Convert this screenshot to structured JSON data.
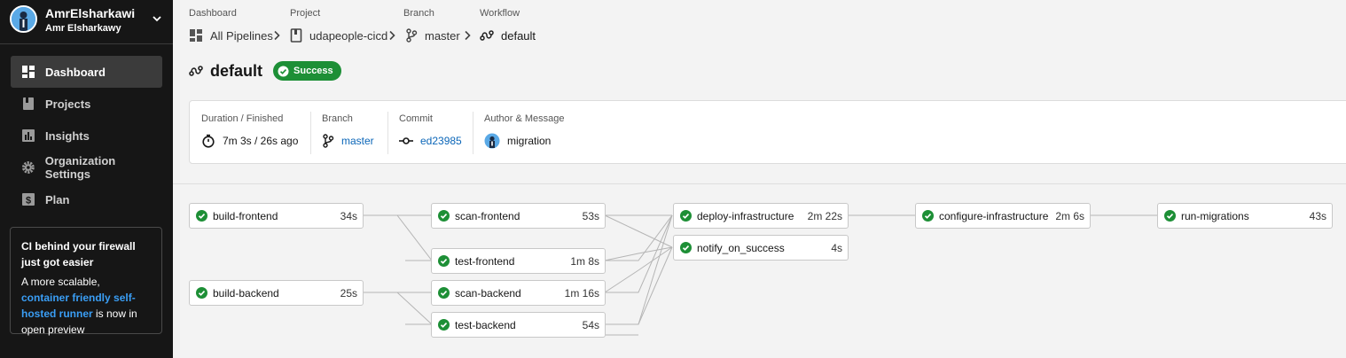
{
  "user": {
    "name": "AmrElsharkawi",
    "subname": "Amr Elsharkawy"
  },
  "nav": [
    {
      "label": "Dashboard",
      "icon": "dashboard-icon",
      "active": true
    },
    {
      "label": "Projects",
      "icon": "projects-icon"
    },
    {
      "label": "Insights",
      "icon": "insights-icon"
    },
    {
      "label": "Organization Settings",
      "icon": "gear-icon"
    },
    {
      "label": "Plan",
      "icon": "dollar-icon"
    }
  ],
  "promo": {
    "title": "CI behind your firewall just got easier",
    "lead": "A more scalable, ",
    "link": "container friendly self-hosted runner",
    "tail": " is now in open preview"
  },
  "breadcrumbs": [
    {
      "label": "Dashboard",
      "value": "All Pipelines",
      "icon": "grid-icon"
    },
    {
      "label": "Project",
      "value": "udapeople-cicd",
      "icon": "bookmark-icon"
    },
    {
      "label": "Branch",
      "value": "master",
      "icon": "branch-icon"
    },
    {
      "label": "Workflow",
      "value": "default",
      "icon": "workflow-icon"
    }
  ],
  "workflow": {
    "title": "default",
    "status": "Success",
    "status_color": "#1d8f36"
  },
  "info": {
    "duration_label": "Duration / Finished",
    "duration_value": "7m 3s / 26s ago",
    "branch_label": "Branch",
    "branch_value": "master",
    "commit_label": "Commit",
    "commit_value": "ed23985",
    "author_label": "Author & Message",
    "author_message": "migration"
  },
  "jobs": [
    {
      "name": "build-frontend",
      "duration": "34s"
    },
    {
      "name": "build-backend",
      "duration": "25s"
    },
    {
      "name": "scan-frontend",
      "duration": "53s"
    },
    {
      "name": "test-frontend",
      "duration": "1m 8s"
    },
    {
      "name": "scan-backend",
      "duration": "1m 16s"
    },
    {
      "name": "test-backend",
      "duration": "54s"
    },
    {
      "name": "deploy-infrastructure",
      "duration": "2m 22s"
    },
    {
      "name": "notify_on_success",
      "duration": "4s"
    },
    {
      "name": "configure-infrastructure",
      "duration": "2m 6s"
    },
    {
      "name": "run-migrations",
      "duration": "43s"
    }
  ]
}
